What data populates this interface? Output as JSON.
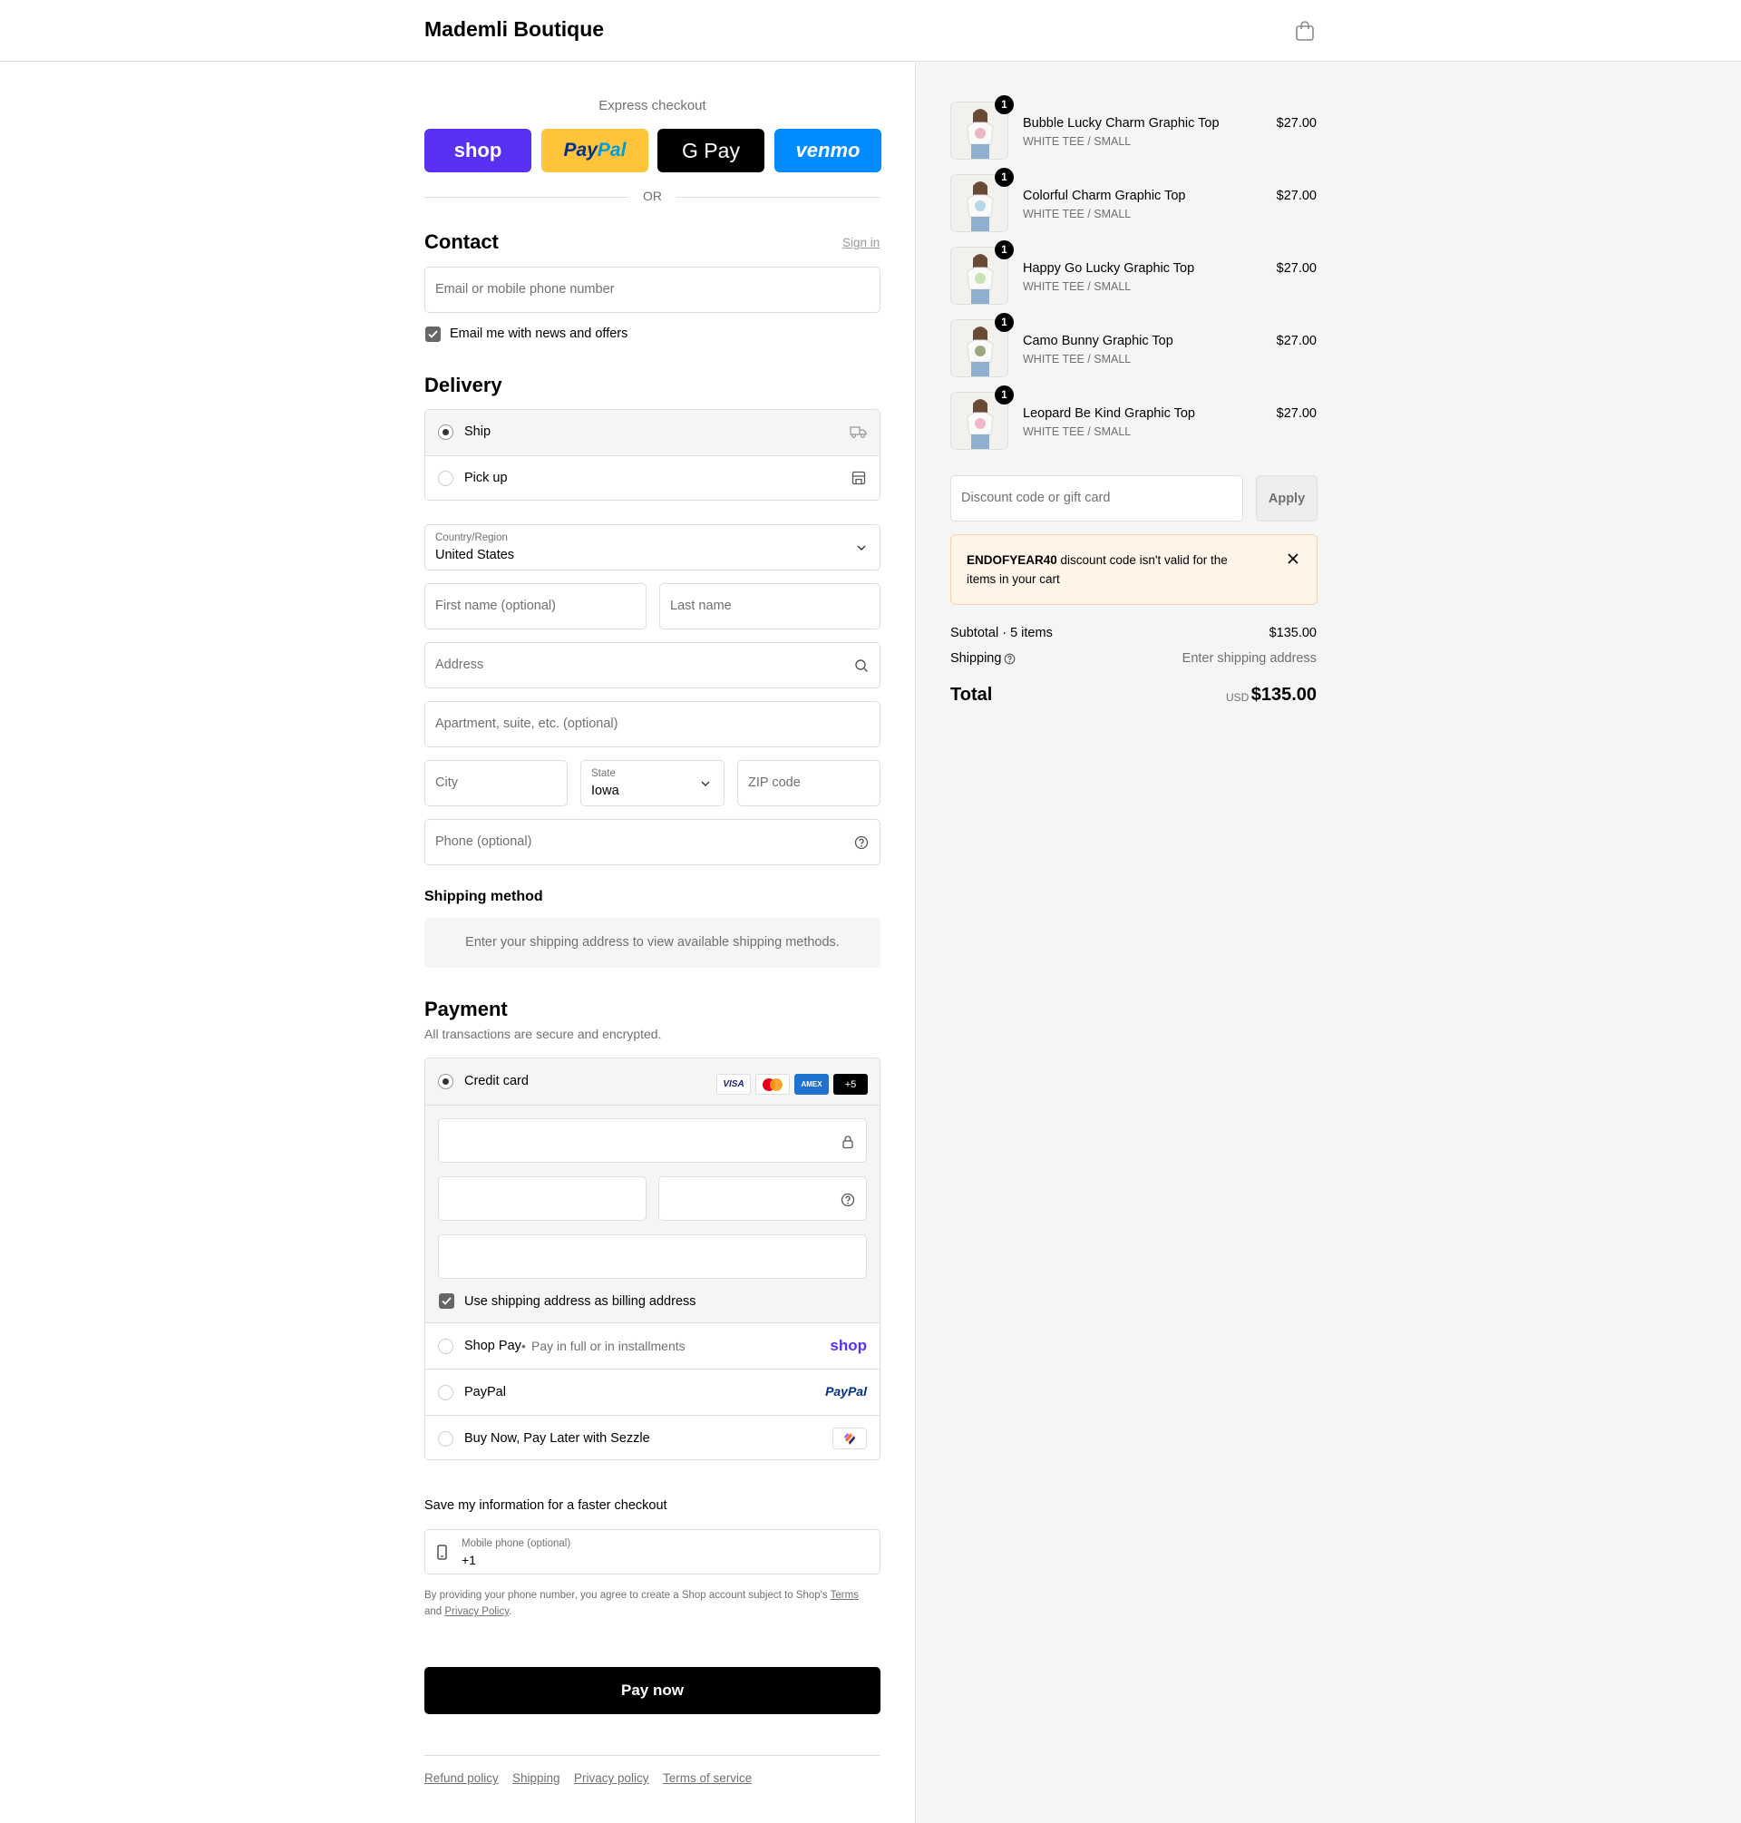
{
  "header": {
    "brand": "Mademli Boutique"
  },
  "express": {
    "label": "Express checkout",
    "buttons": {
      "shop": "shop",
      "paypal": "PayPal",
      "gpay": "G Pay",
      "venmo": "venmo"
    },
    "or": "OR"
  },
  "contact": {
    "title": "Contact",
    "sign_in": "Sign in",
    "email_placeholder": "Email or mobile phone number",
    "newsletter_label": "Email me with news and offers",
    "newsletter_checked": true
  },
  "delivery": {
    "title": "Delivery",
    "options": [
      {
        "label": "Ship",
        "selected": true
      },
      {
        "label": "Pick up",
        "selected": false
      }
    ],
    "country_label": "Country/Region",
    "country_value": "United States",
    "first_name": "First name (optional)",
    "last_name": "Last name",
    "address": "Address",
    "apartment": "Apartment, suite, etc. (optional)",
    "city": "City",
    "state_label": "State",
    "state_value": "Iowa",
    "zip": "ZIP code",
    "phone": "Phone (optional)"
  },
  "shipping_method": {
    "title": "Shipping method",
    "notice": "Enter your shipping address to view available shipping methods."
  },
  "payment": {
    "title": "Payment",
    "subtitle": "All transactions are secure and encrypted.",
    "credit_card_label": "Credit card",
    "card_badges": [
      "VISA",
      "AMEX",
      "+5"
    ],
    "billing_same_label": "Use shipping address as billing address",
    "shop_pay_label": "Shop Pay",
    "shop_pay_sub": "Pay in full or in installments",
    "shop_pay_logo": "shop",
    "paypal_label": "PayPal",
    "paypal_logo": "PayPal",
    "sezzle_label": "Buy Now, Pay Later with Sezzle"
  },
  "save_info": {
    "title": "Save my information for a faster checkout",
    "phone_label": "Mobile phone (optional)",
    "phone_value": "+1",
    "legal_1": "By providing your phone number, you agree to create a Shop account subject to Shop's",
    "terms": "Terms",
    "and": "and",
    "privacy": "Privacy Policy",
    "period": "."
  },
  "pay_button": "Pay now",
  "footer_links": [
    "Refund policy",
    "Shipping",
    "Privacy policy",
    "Terms of service"
  ],
  "cart": {
    "items": [
      {
        "name": "Bubble Lucky Charm Graphic Top",
        "variant": "WHITE TEE / SMALL",
        "price": "$27.00",
        "qty": "1"
      },
      {
        "name": "Colorful Charm Graphic Top",
        "variant": "WHITE TEE / SMALL",
        "price": "$27.00",
        "qty": "1"
      },
      {
        "name": "Happy Go Lucky Graphic Top",
        "variant": "WHITE TEE / SMALL",
        "price": "$27.00",
        "qty": "1"
      },
      {
        "name": "Camo Bunny Graphic Top",
        "variant": "WHITE TEE / SMALL",
        "price": "$27.00",
        "qty": "1"
      },
      {
        "name": "Leopard Be Kind Graphic Top",
        "variant": "WHITE TEE / SMALL",
        "price": "$27.00",
        "qty": "1"
      }
    ],
    "discount_placeholder": "Discount code or gift card",
    "apply_label": "Apply",
    "alert_code": "ENDOFYEAR40",
    "alert_text": "discount code isn't valid for the items in your cart",
    "subtotal_label": "Subtotal · 5 items",
    "subtotal_value": "$135.00",
    "shipping_label": "Shipping",
    "shipping_value": "Enter shipping address",
    "total_label": "Total",
    "total_currency": "USD",
    "total_value": "$135.00"
  }
}
